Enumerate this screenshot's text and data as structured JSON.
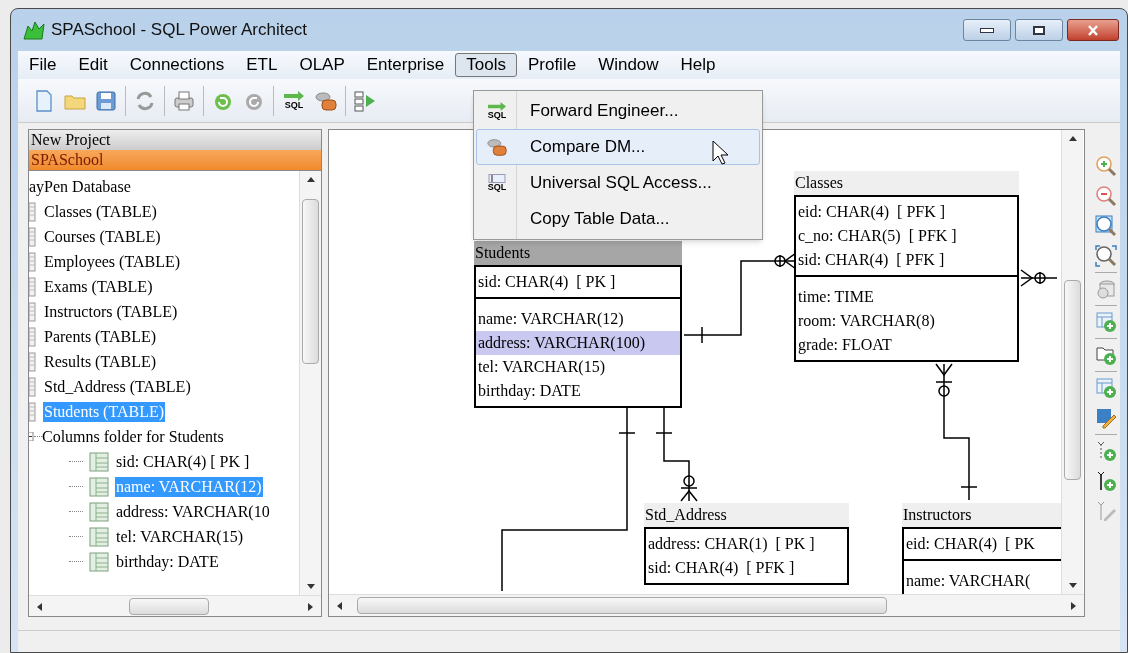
{
  "window": {
    "title": "SPASchool - SQL Power Architect"
  },
  "menu_bar": [
    {
      "label": "File",
      "selected": false
    },
    {
      "label": "Edit",
      "selected": false
    },
    {
      "label": "Connections",
      "selected": false
    },
    {
      "label": "ETL",
      "selected": false
    },
    {
      "label": "OLAP",
      "selected": false
    },
    {
      "label": "Enterprise",
      "selected": false
    },
    {
      "label": "Tools",
      "selected": true
    },
    {
      "label": "Profile",
      "selected": false
    },
    {
      "label": "Window",
      "selected": false
    },
    {
      "label": "Help",
      "selected": false
    }
  ],
  "toolbar": [
    {
      "kind": "new"
    },
    {
      "kind": "open"
    },
    {
      "kind": "save"
    },
    {
      "kind": "separator"
    },
    {
      "kind": "refresh"
    },
    {
      "kind": "separator"
    },
    {
      "kind": "print"
    },
    {
      "kind": "separator"
    },
    {
      "kind": "undo"
    },
    {
      "kind": "redo"
    },
    {
      "kind": "separator"
    },
    {
      "kind": "forward-sql",
      "label": "SQL"
    },
    {
      "kind": "compare"
    },
    {
      "kind": "separator"
    },
    {
      "kind": "split"
    }
  ],
  "tools_menu": [
    {
      "label": "Forward Engineer...",
      "kind": "forward-sql",
      "icon_text": "SQL",
      "selected": false
    },
    {
      "label": "Compare DM...",
      "kind": "compare",
      "selected": true
    },
    {
      "label": "Universal SQL Access...",
      "kind": "sql-access",
      "icon_text": "SQL",
      "selected": false
    },
    {
      "label": "Copy Table Data...",
      "selected": false
    }
  ],
  "project_tabs": [
    {
      "label": "New Project",
      "selected": false
    },
    {
      "label": "SPASchool",
      "selected": true
    }
  ],
  "tree": {
    "root": "ayPen Database",
    "items": [
      {
        "label": "Classes (TABLE)",
        "selected": false
      },
      {
        "label": "Courses (TABLE)",
        "selected": false
      },
      {
        "label": "Employees (TABLE)",
        "selected": false
      },
      {
        "label": "Exams (TABLE)",
        "selected": false
      },
      {
        "label": "Instructors (TABLE)",
        "selected": false
      },
      {
        "label": "Parents (TABLE)",
        "selected": false
      },
      {
        "label": "Results (TABLE)",
        "selected": false
      },
      {
        "label": "Std_Address (TABLE)",
        "selected": false
      },
      {
        "label": "Students (TABLE)",
        "selected": true,
        "children": [
          {
            "label": "Columns folder for Students",
            "children": [
              {
                "label": "sid: CHAR(4)  [ PK ]",
                "selected": false
              },
              {
                "label": "name: VARCHAR(12)",
                "selected": true
              },
              {
                "label": "address: VARCHAR(10",
                "selected": false
              },
              {
                "label": "tel: VARCHAR(15)",
                "selected": false
              },
              {
                "label": "birthday: DATE",
                "selected": false
              }
            ]
          }
        ]
      }
    ]
  },
  "diagram": {
    "tables": [
      {
        "name": "Students",
        "selected": true,
        "primary_key": [
          {
            "label": "sid: CHAR(4)  [ PK ]",
            "selected": false
          }
        ],
        "columns": [
          {
            "label": "name: VARCHAR(12)",
            "selected": false
          },
          {
            "label": "address: VARCHAR(100)",
            "selected": true
          },
          {
            "label": "tel: VARCHAR(15)",
            "selected": false
          },
          {
            "label": "birthday: DATE",
            "selected": false
          }
        ]
      },
      {
        "name": "Classes",
        "selected": false,
        "primary_key": [
          {
            "label": "eid: CHAR(4)  [ PFK ]",
            "selected": false
          },
          {
            "label": "c_no: CHAR(5)  [ PFK ]",
            "selected": false
          },
          {
            "label": "sid: CHAR(4)  [ PFK ]",
            "selected": false
          }
        ],
        "columns": [
          {
            "label": "time: TIME",
            "selected": false
          },
          {
            "label": "room: VARCHAR(8)",
            "selected": false
          },
          {
            "label": "grade: FLOAT",
            "selected": false
          }
        ]
      },
      {
        "name": "Std_Address",
        "selected": false,
        "primary_key": [
          {
            "label": "address: CHAR(1)  [ PK ]",
            "selected": false
          },
          {
            "label": "sid: CHAR(4)  [ PFK ]",
            "selected": false
          }
        ]
      },
      {
        "name": "Instructors",
        "selected": false,
        "primary_key": [
          {
            "label": "eid: CHAR(4)  [ PK",
            "selected": false
          }
        ],
        "columns": [
          {
            "label": "name: VARCHAR(",
            "selected": false
          }
        ]
      }
    ]
  },
  "right_toolbar": [
    {
      "kind": "zoom-in"
    },
    {
      "kind": "zoom-out"
    },
    {
      "kind": "zoom-box"
    },
    {
      "kind": "zoom-fit"
    },
    {
      "kind": "separator"
    },
    {
      "kind": "database"
    },
    {
      "kind": "separator"
    },
    {
      "kind": "add-table"
    },
    {
      "kind": "separator"
    },
    {
      "kind": "add-folder"
    },
    {
      "kind": "separator"
    },
    {
      "kind": "add-table"
    },
    {
      "kind": "edit"
    },
    {
      "kind": "separator"
    },
    {
      "kind": "add-relation"
    },
    {
      "kind": "add-id-relation"
    },
    {
      "kind": "edit-relation"
    }
  ]
}
